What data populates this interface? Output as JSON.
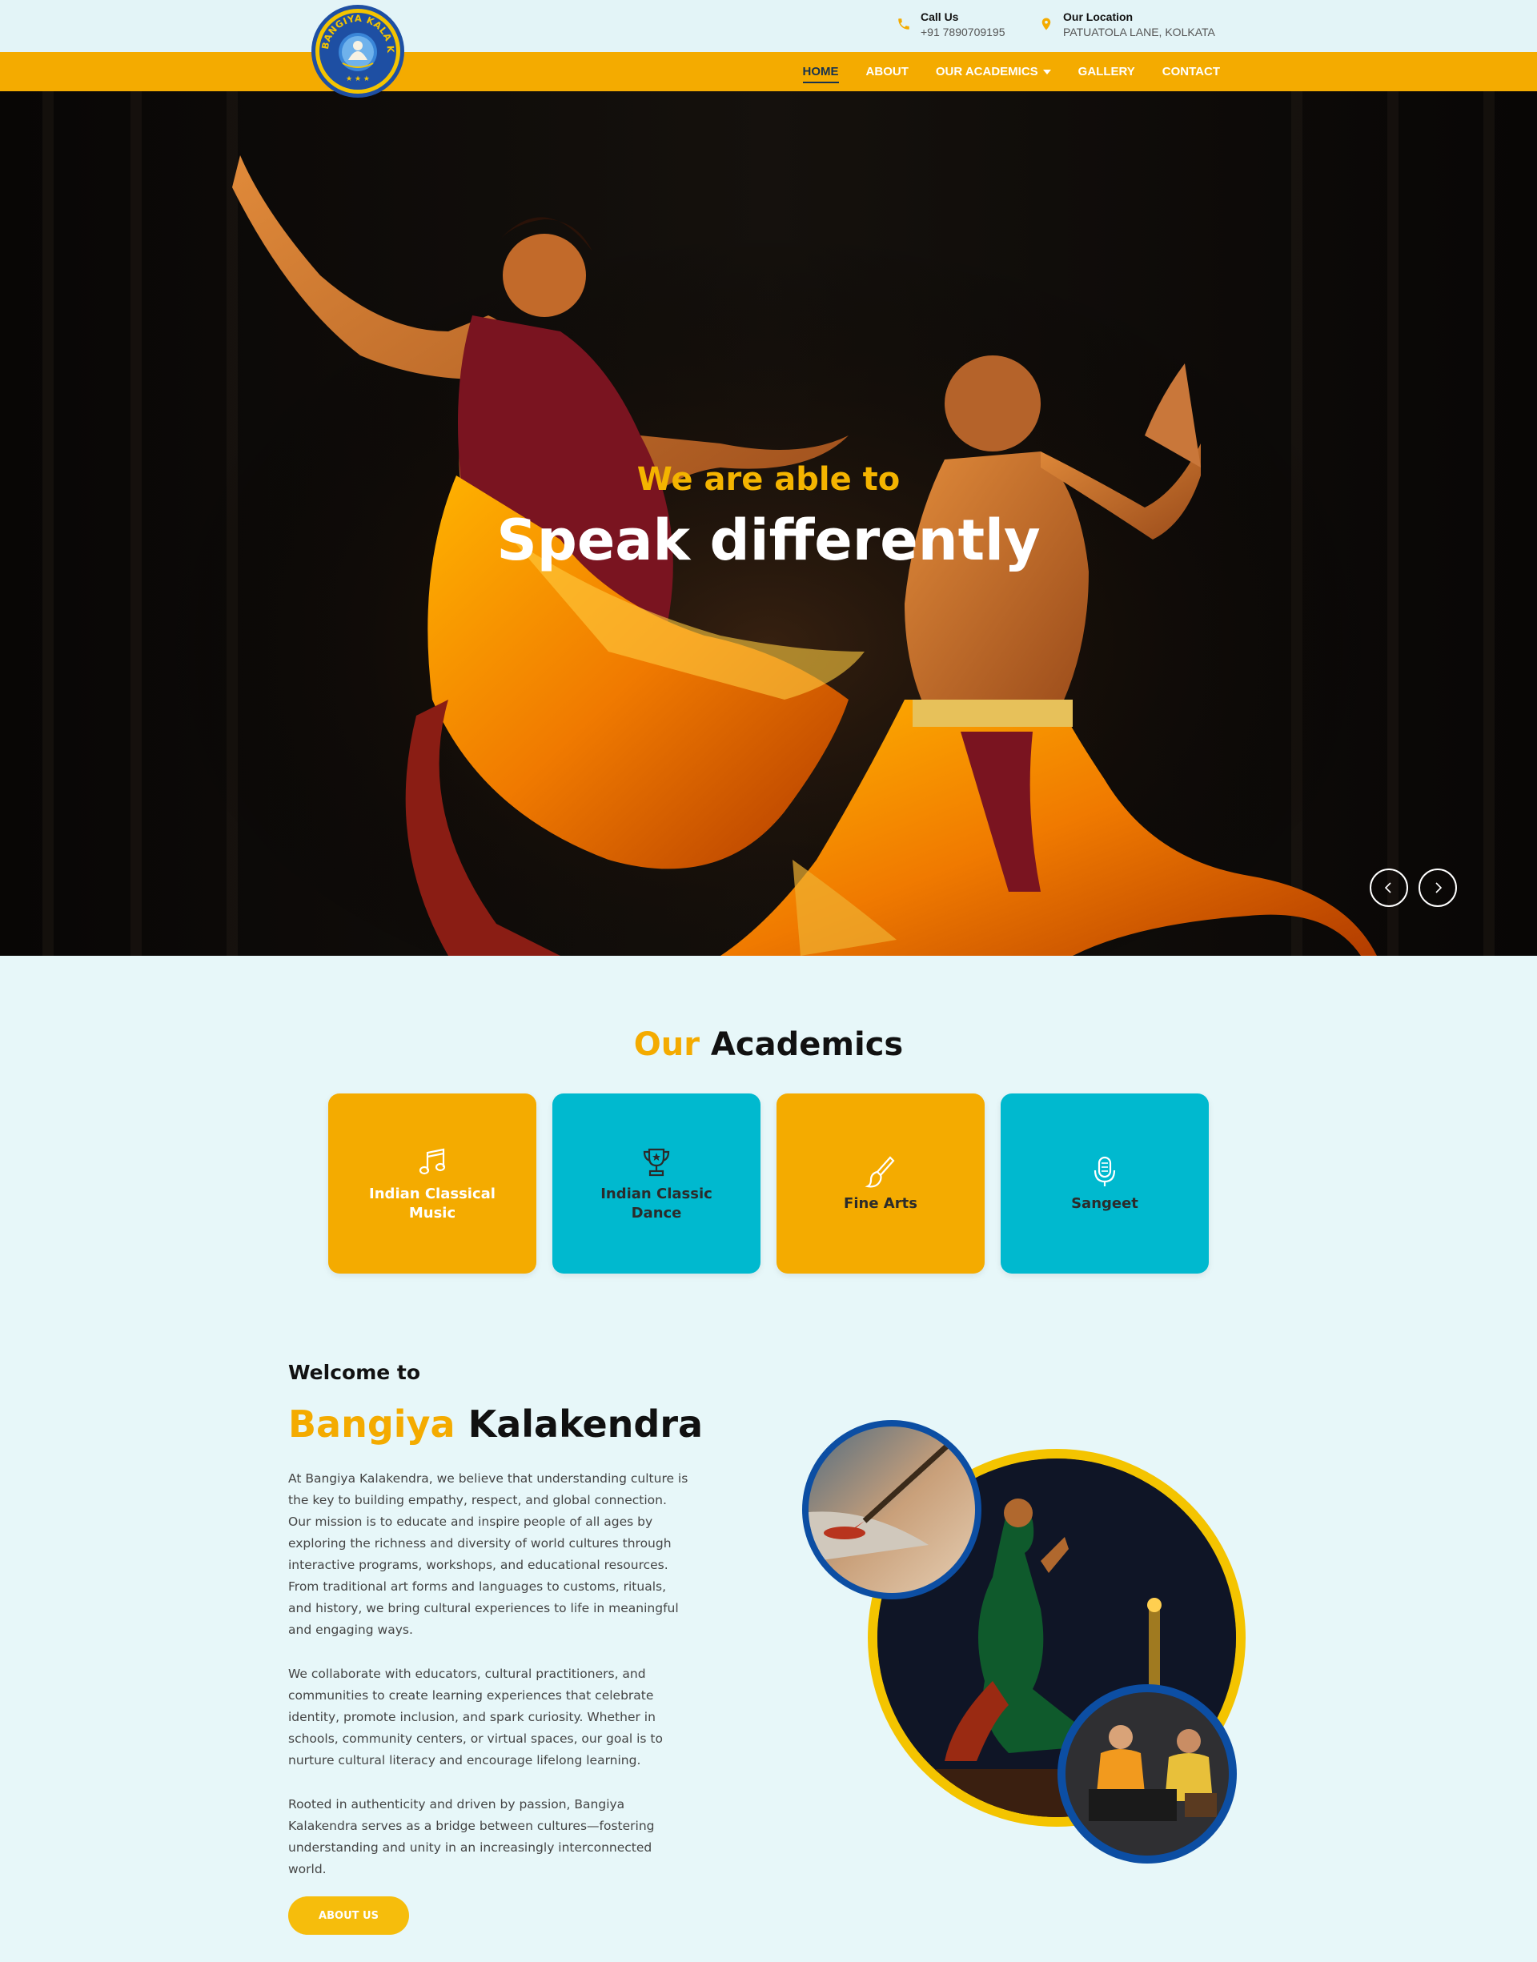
{
  "topbar": {
    "call": {
      "title": "Call Us",
      "value": "+91 7890709195",
      "icon": "phone-icon"
    },
    "location": {
      "title": "Our Location",
      "value": "PATUATOLA LANE, KOLKATA",
      "icon": "location-pin-icon"
    }
  },
  "logo": {
    "text": "BANGIYA KALA KENDRA"
  },
  "nav": {
    "items": [
      {
        "label": "HOME",
        "active": true
      },
      {
        "label": "ABOUT"
      },
      {
        "label": "OUR ACADEMICS",
        "has_dropdown": true
      },
      {
        "label": "GALLERY"
      },
      {
        "label": "CONTACT"
      }
    ]
  },
  "hero": {
    "subtitle": "We are able to",
    "title": "Speak differently",
    "prev_icon": "chevron-left-icon",
    "next_icon": "chevron-right-icon"
  },
  "academics": {
    "heading_highlight": "Our",
    "heading_rest": "Academics",
    "cards": [
      {
        "label": "Indian Classical Music",
        "icon": "music-note-icon",
        "color": "#f4ab00"
      },
      {
        "label": "Indian Classic Dance",
        "icon": "trophy-icon",
        "color": "#00b9cf"
      },
      {
        "label": "Fine Arts",
        "icon": "paintbrush-icon",
        "color": "#f4ab00"
      },
      {
        "label": "Sangeet",
        "icon": "microphone-icon",
        "color": "#00b9cf"
      }
    ]
  },
  "welcome": {
    "pre": "Welcome to",
    "title_highlight": "Bangiya",
    "title_rest": "Kalakendra",
    "paragraphs": [
      "At Bangiya Kalakendra, we believe that understanding culture is the key to building empathy, respect, and global connection. Our mission is to educate and inspire people of all ages by exploring the richness and diversity of world cultures through interactive programs, workshops, and educational resources. From traditional art forms and languages to customs, rituals, and history, we bring cultural experiences to life in meaningful and engaging ways.",
      "We collaborate with educators, cultural practitioners, and communities to create learning experiences that celebrate identity, promote inclusion, and spark curiosity. Whether in schools, community centers, or virtual spaces, our goal is to nurture cultural literacy and encourage lifelong learning.",
      "Rooted in authenticity and driven by passion, Bangiya Kalakendra serves as a bridge between cultures—fostering understanding and unity in an increasingly interconnected world."
    ],
    "button": "ABOUT US"
  },
  "colors": {
    "brand_yellow": "#f4ab00",
    "brand_teal": "#00b9cf",
    "page_bg": "#e7f7f9",
    "nav_active": "#16324f",
    "logo_blue": "#1e4fa3"
  }
}
